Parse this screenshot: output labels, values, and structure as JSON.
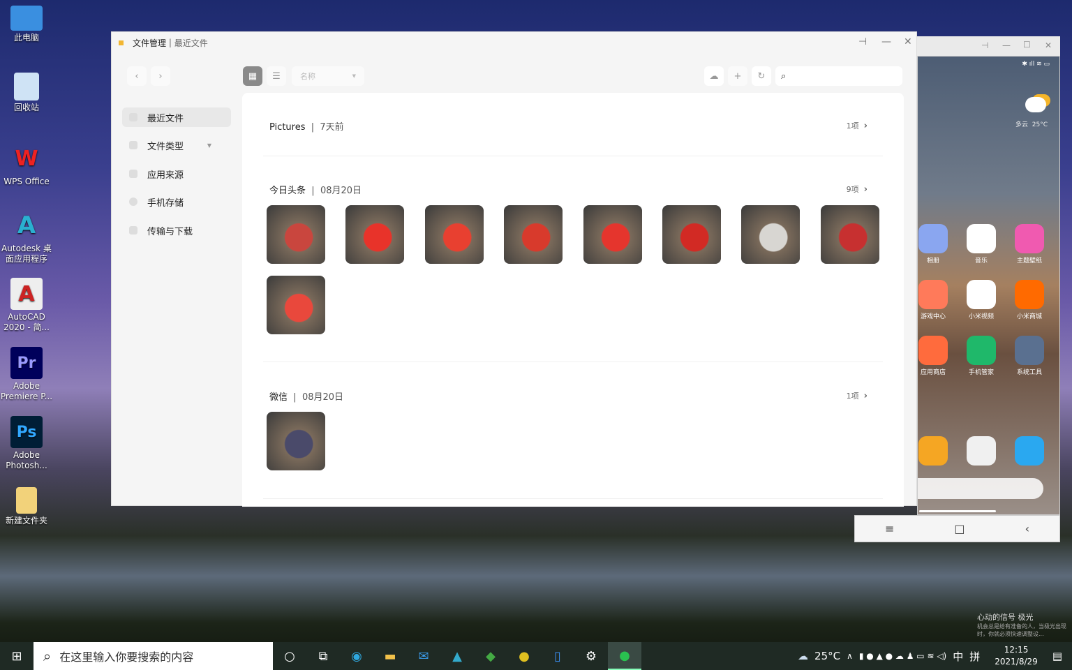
{
  "desktop": {
    "icons": [
      "此电脑",
      "回收站",
      "WPS Office",
      "Autodesk 桌面应用程序",
      "AutoCAD 2020 - 简...",
      "Adobe Premiere P...",
      "Adobe Photosh...",
      "新建文件夹"
    ],
    "notification": {
      "title": "心动的信号 极光",
      "body": "机会总是给有准备的人，当极光出现时，你就必须快速调整设..."
    }
  },
  "window": {
    "app": "文件管理",
    "page": "最近文件",
    "sort_label": "名称",
    "sidebar": [
      "最近文件",
      "文件类型",
      "应用来源",
      "手机存储",
      "传输与下载"
    ],
    "sections": [
      {
        "title": "Pictures",
        "date": "7天前",
        "count": "1项",
        "thumbs": []
      },
      {
        "title": "今日头条",
        "date": "08月20日",
        "count": "9项",
        "thumbs": [
          "#c9463e",
          "#e8332a",
          "#e84030",
          "#d83a2c",
          "#e5352d",
          "#d22a24",
          "#d8d6d2",
          "#c73030",
          "#e9483c"
        ]
      },
      {
        "title": "微信",
        "date": "08月20日",
        "count": "1项",
        "thumbs": [
          "#4a4a6a"
        ]
      }
    ]
  },
  "phone": {
    "weather": "多云",
    "temp": "25°C",
    "apps": [
      "相册",
      "音乐",
      "主题壁纸",
      "游戏中心",
      "小米视频",
      "小米商城",
      "应用商店",
      "手机管家",
      "系统工具"
    ],
    "app_colors": [
      "#8aa6f0",
      "#ffffff",
      "#f05ab0",
      "#ff7a5a",
      "#ffffff",
      "#ff6a00",
      "#ff6b3d",
      "#1fb86a",
      "#5a7090"
    ],
    "dock_colors": [
      "#f5a623",
      "#f0f0f0",
      "#2aa8f0"
    ]
  },
  "taskbar": {
    "search_placeholder": "在这里输入你要搜索的内容",
    "weather": "25°C",
    "ime1": "中",
    "ime2": "拼",
    "time": "12:15",
    "date": "2021/8/29"
  }
}
